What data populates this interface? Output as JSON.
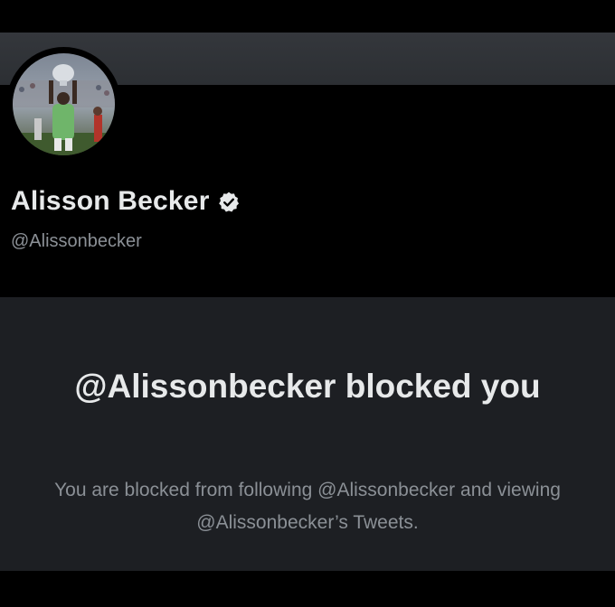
{
  "profile": {
    "display_name": "Alisson Becker",
    "handle": "@Alissonbecker",
    "verified": true,
    "avatar_icon": "profile-photo-trophy"
  },
  "blocked": {
    "title": "@Alissonbecker blocked you",
    "message": "You are blocked from following @Alissonbecker and viewing @Alissonbecker’s Tweets."
  },
  "colors": {
    "background": "#000000",
    "banner": "#2f3236",
    "panel": "#1d1f23",
    "primary_text": "#e7e9ea",
    "secondary_text": "#8b9096"
  }
}
